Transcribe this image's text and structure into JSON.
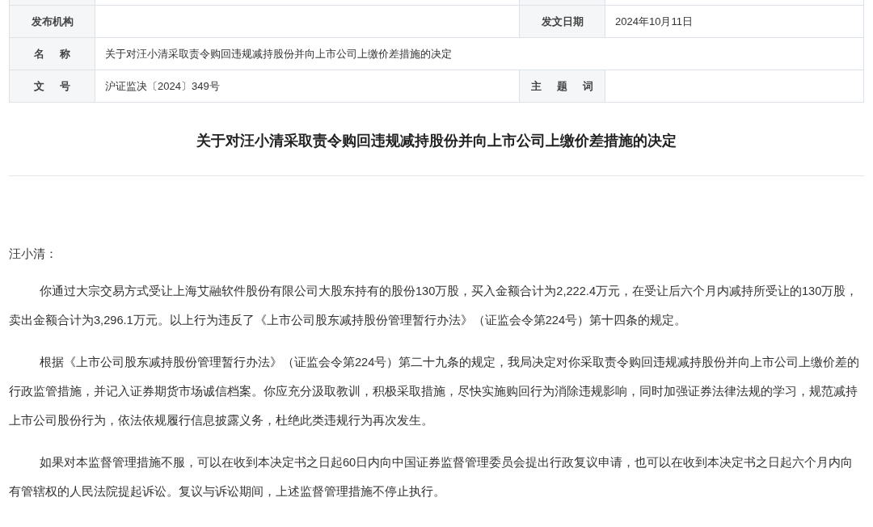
{
  "info_table": {
    "rows": [
      {
        "cells": [
          {
            "kind": "label",
            "text": "发布机构"
          },
          {
            "kind": "value",
            "text": ""
          },
          {
            "kind": "label",
            "text": "发文日期"
          },
          {
            "kind": "value",
            "text": "2024年10月11日"
          }
        ]
      },
      {
        "cells": [
          {
            "kind": "label",
            "text": "名 称"
          },
          {
            "kind": "wide",
            "text": "关于对汪小清采取责令购回违规减持股份并向上市公司上缴价差措施的决定"
          }
        ]
      },
      {
        "cells": [
          {
            "kind": "label",
            "text": "文 号"
          },
          {
            "kind": "value",
            "text": "沪证监决〔2024〕349号"
          },
          {
            "kind": "label",
            "text": "主 题 词"
          },
          {
            "kind": "value",
            "text": ""
          }
        ]
      }
    ]
  },
  "title": "关于对汪小清采取责令购回违规减持股份并向上市公司上缴价差措施的决定",
  "salutation": "汪小清：",
  "paragraphs": [
    "你通过大宗交易方式受让上海艾融软件股份有限公司大股东持有的股份130万股，买入金额合计为2,222.4万元，在受让后六个月内减持所受让的130万股，卖出金额合计为3,296.1万元。以上行为违反了《上市公司股东减持股份管理暂行办法》（证监会令第224号）第十四条的规定。",
    "根据《上市公司股东减持股份管理暂行办法》（证监会令第224号）第二十九条的规定，我局决定对你采取责令购回违规减持股份并向上市公司上缴价差的行政监管措施，并记入证券期货市场诚信档案。你应充分汲取教训，积极采取措施，尽快实施购回行为消除违规影响，同时加强证券法律法规的学习，规范减持上市公司股份行为，依法依规履行信息披露义务，杜绝此类违规行为再次发生。",
    "如果对本监督管理措施不服，可以在收到本决定书之日起60日内向中国证券监督管理委员会提出行政复议申请，也可以在收到本决定书之日起六个月内向有管辖权的人民法院提起诉讼。复议与诉讼期间，上述监督管理措施不停止执行。"
  ]
}
